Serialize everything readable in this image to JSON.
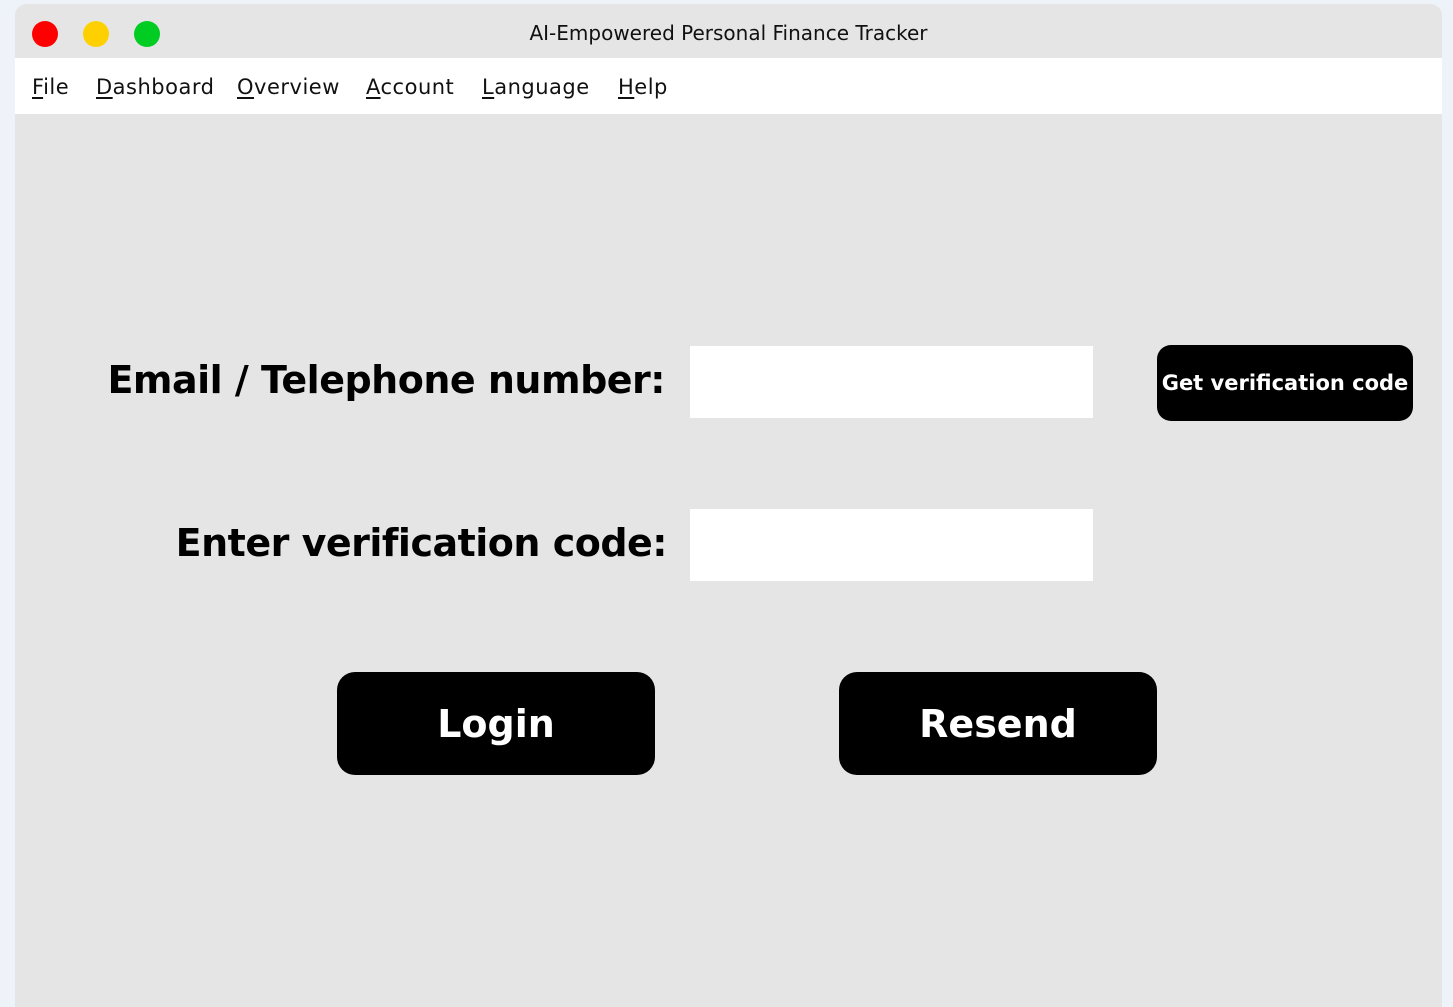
{
  "window": {
    "title": "AI-Empowered Personal Finance Tracker",
    "traffic_lights": {
      "close_color": "#ff0000",
      "minimize_color": "#ffd000",
      "maximize_color": "#00cc22"
    }
  },
  "menubar": {
    "items": [
      {
        "mnemonic": "F",
        "rest": "ile"
      },
      {
        "mnemonic": "D",
        "rest": "ashboard"
      },
      {
        "mnemonic": "O",
        "rest": "verview"
      },
      {
        "mnemonic": "A",
        "rest": "ccount"
      },
      {
        "mnemonic": "L",
        "rest": "anguage"
      },
      {
        "mnemonic": "H",
        "rest": "elp"
      }
    ]
  },
  "form": {
    "contact_label": "Email / Telephone number:",
    "contact_value": "",
    "code_label": "Enter verification code:",
    "code_value": "",
    "get_code_label": "Get verification code",
    "login_label": "Login",
    "resend_label": "Resend"
  },
  "colors": {
    "window_bg": "#e5e5e5",
    "menubar_bg": "#ffffff",
    "button_bg": "#000000",
    "button_text": "#ffffff"
  }
}
